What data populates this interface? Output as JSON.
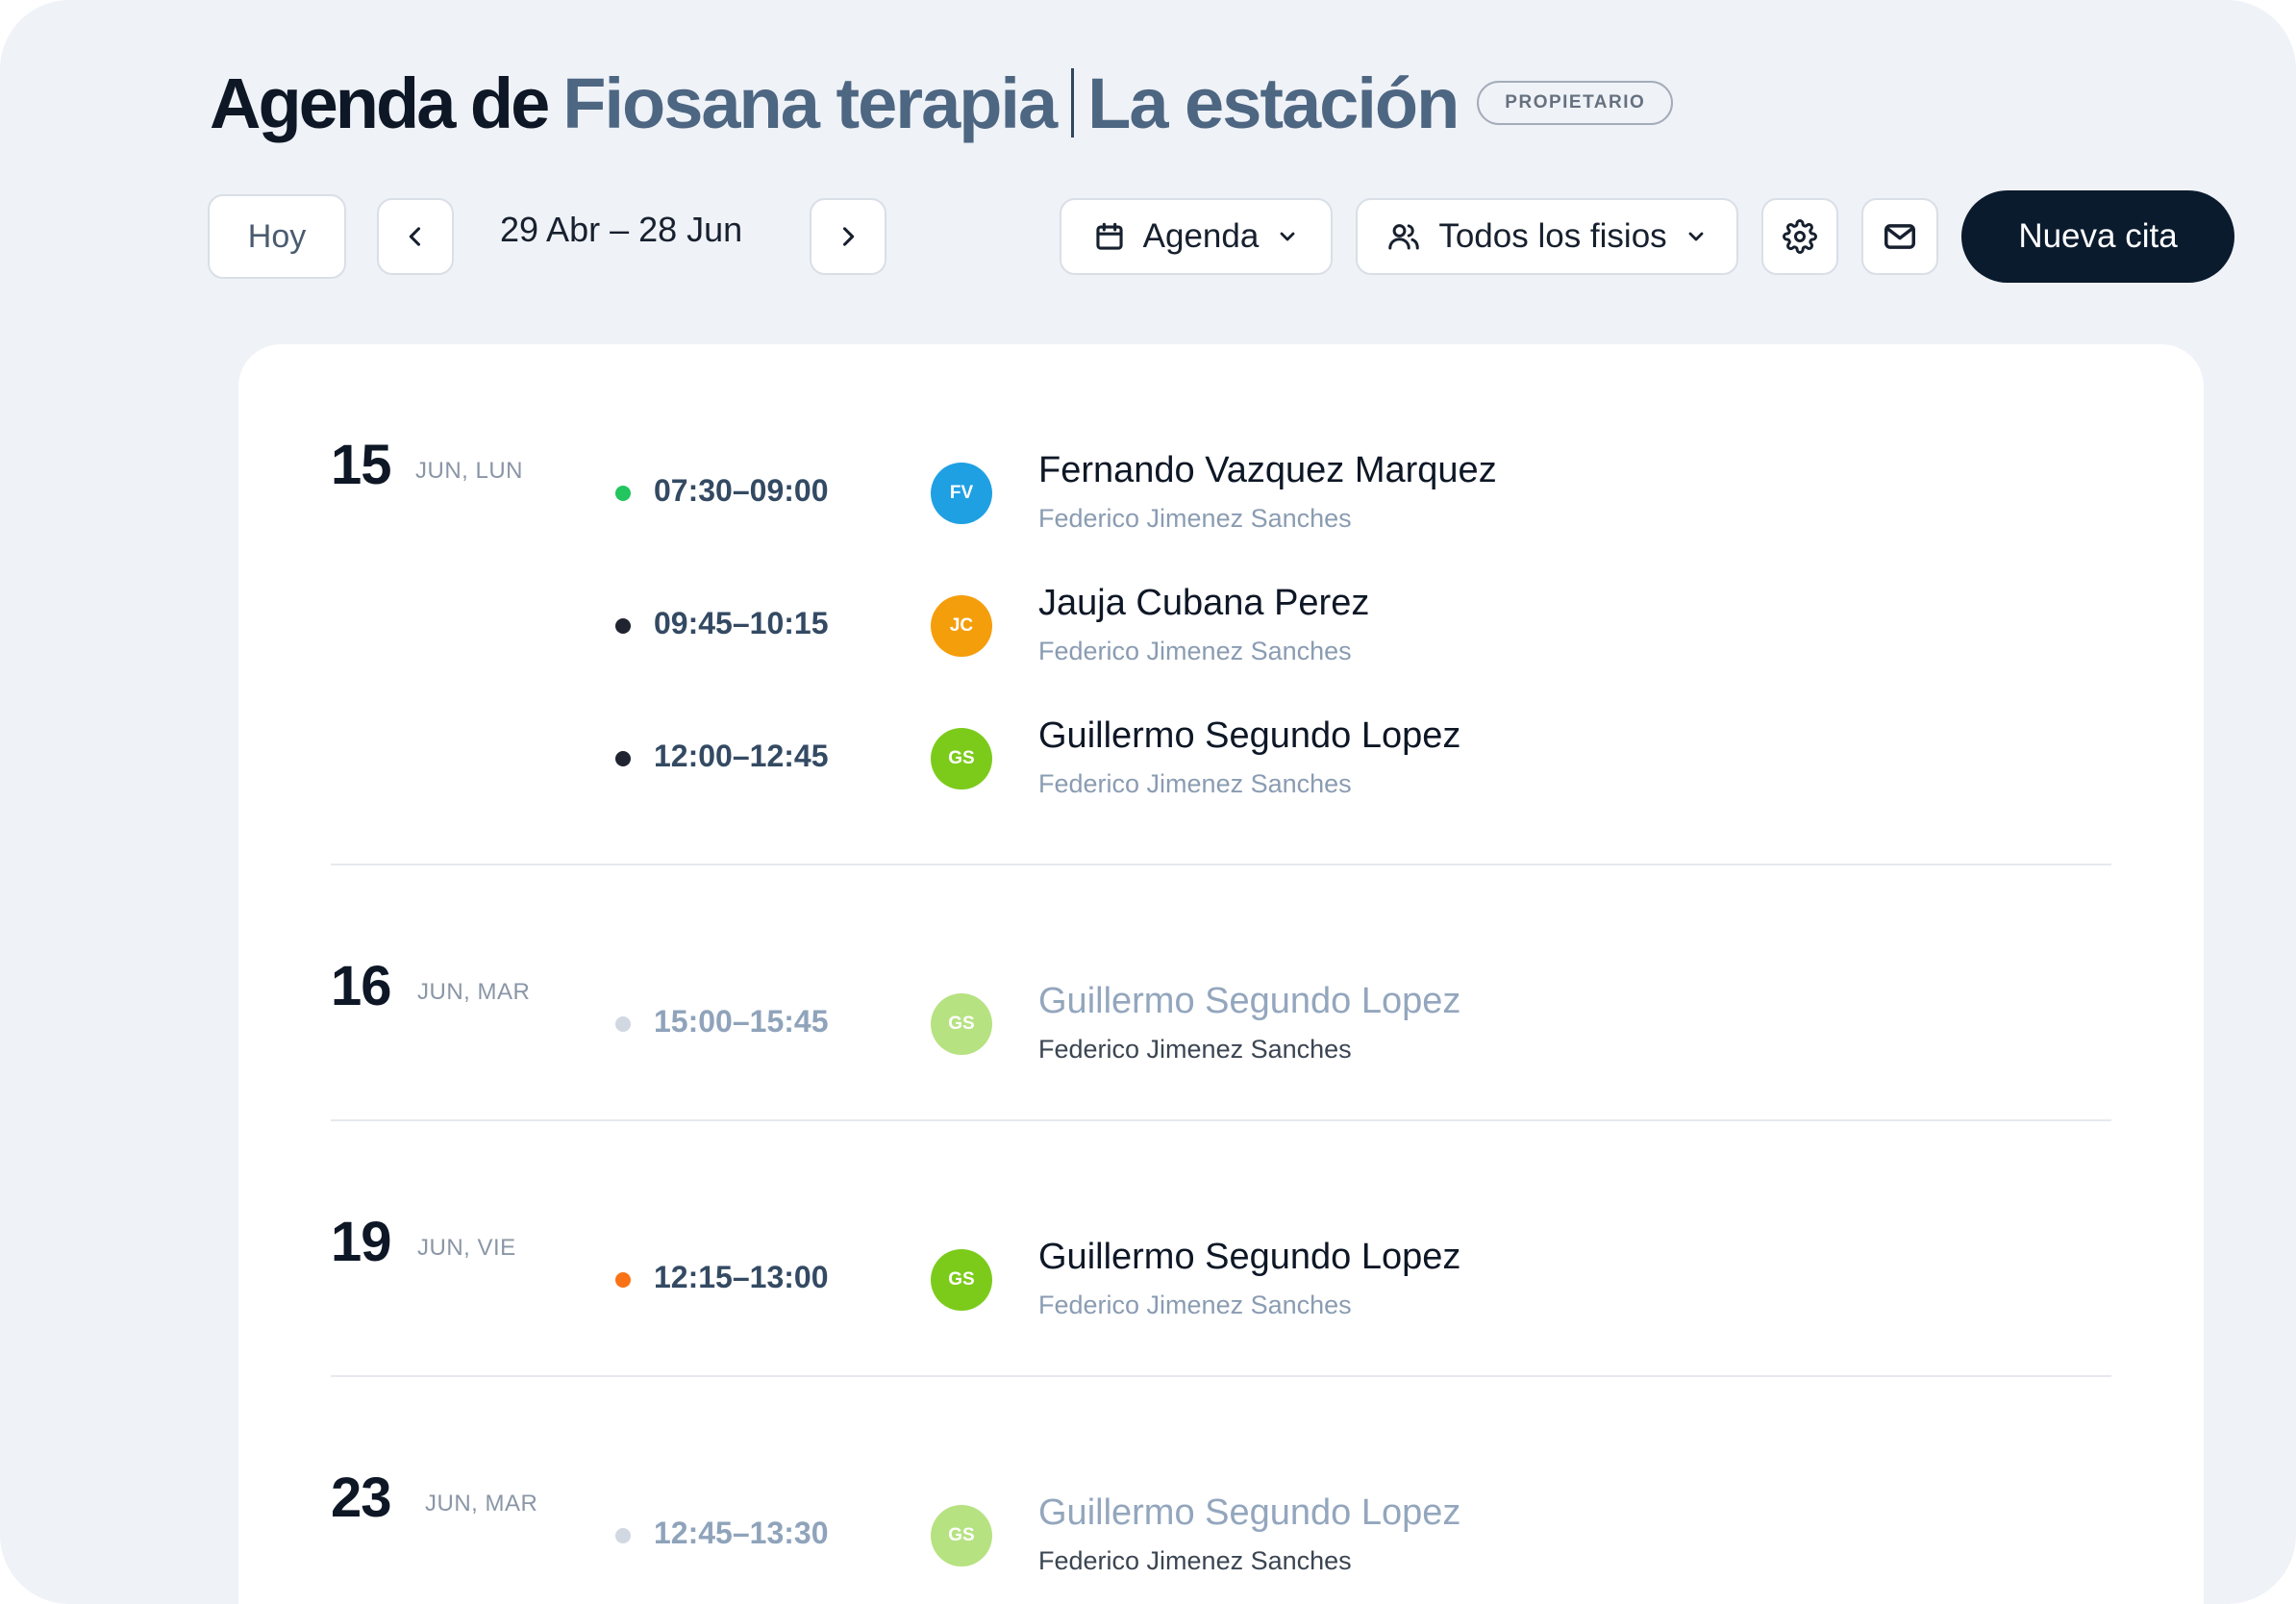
{
  "header": {
    "title_prefix": "Agenda de",
    "clinic_name": "Fiosana terapia",
    "location": "La estación",
    "role_badge": "PROPIETARIO"
  },
  "toolbar": {
    "today_label": "Hoy",
    "date_range": "29 Abr – 28 Jun",
    "view_label": "Agenda",
    "staff_filter_label": "Todos los fisios",
    "new_button_label": "Nueva cita",
    "icons": [
      "chevron-left-icon",
      "chevron-right-icon",
      "calendar-icon",
      "chevron-down-icon",
      "users-icon",
      "gear-icon",
      "mail-icon"
    ]
  },
  "colors": {
    "status_confirmed": "#22c55e",
    "status_scheduled": "#1f2430",
    "status_pending": "#f97316",
    "status_past": "#d1d8e1",
    "primary_dark": "#0b1b2e",
    "accent_title": "#4d6682"
  },
  "days": [
    {
      "day": "15",
      "label": "JUN, LUN",
      "appointments": [
        {
          "time": "07:30–09:00",
          "status_color": "#22c55e",
          "initials": "FV",
          "avatar_color": "#1fa0e3",
          "patient": "Fernando Vazquez Marquez",
          "therapist": "Federico Jimenez Sanches",
          "faded": false
        },
        {
          "time": "09:45–10:15",
          "status_color": "#1f2430",
          "initials": "JC",
          "avatar_color": "#f59e0b",
          "patient": "Jauja Cubana Perez",
          "therapist": "Federico Jimenez Sanches",
          "faded": false
        },
        {
          "time": "12:00–12:45",
          "status_color": "#1f2430",
          "initials": "GS",
          "avatar_color": "#7ccb1b",
          "patient": "Guillermo Segundo Lopez",
          "therapist": "Federico Jimenez Sanches",
          "faded": false
        }
      ]
    },
    {
      "day": "16",
      "label": "JUN, MAR",
      "appointments": [
        {
          "time": "15:00–15:45",
          "status_color": "#d1d8e1",
          "initials": "GS",
          "avatar_color": "#7ccb1b",
          "patient": "Guillermo Segundo Lopez",
          "therapist": "Federico Jimenez Sanches",
          "faded": true
        }
      ]
    },
    {
      "day": "19",
      "label": "JUN, VIE",
      "appointments": [
        {
          "time": "12:15–13:00",
          "status_color": "#f97316",
          "initials": "GS",
          "avatar_color": "#7ccb1b",
          "patient": "Guillermo Segundo Lopez",
          "therapist": "Federico Jimenez Sanches",
          "faded": false
        }
      ]
    },
    {
      "day": "23",
      "label": "JUN, MAR",
      "appointments": [
        {
          "time": "12:45–13:30",
          "status_color": "#d1d8e1",
          "initials": "GS",
          "avatar_color": "#7ccb1b",
          "patient": "Guillermo Segundo Lopez",
          "therapist": "Federico Jimenez Sanches",
          "faded": true
        }
      ]
    }
  ]
}
